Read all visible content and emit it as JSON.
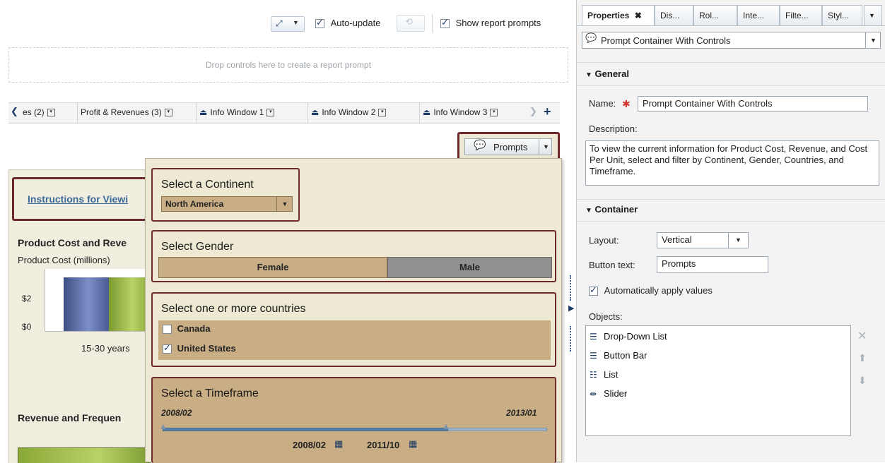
{
  "toolbar": {
    "auto_update_label": "Auto-update",
    "show_prompts_label": "Show report prompts"
  },
  "drop_zone": {
    "text": "Drop controls here to create a report prompt"
  },
  "report_tabs": [
    {
      "label": "es (2)"
    },
    {
      "label": "Profit & Revenues (3)"
    },
    {
      "label": "Info Window 1"
    },
    {
      "label": "Info Window 2"
    },
    {
      "label": "Info Window 3"
    }
  ],
  "prompts_button": {
    "label": "Prompts"
  },
  "report": {
    "instructions_link": "Instructions for Viewi",
    "chart1_title": "Product Cost and Reve",
    "chart1_ylabel": "Product Cost (millions)",
    "chart1_ticks": [
      "$2",
      "$0"
    ],
    "chart1_category": "15-30 years",
    "chart2_title": "Revenue and Frequen"
  },
  "prompt_panel": {
    "continent": {
      "title": "Select a Continent",
      "value": "North America"
    },
    "gender": {
      "title": "Select Gender",
      "options": [
        "Female",
        "Male"
      ],
      "selected": "Female"
    },
    "countries": {
      "title": "Select one or more countries",
      "items": [
        {
          "label": "Canada",
          "checked": false
        },
        {
          "label": "United States",
          "checked": true
        }
      ]
    },
    "timeframe": {
      "title": "Select a Timeframe",
      "min": "2008/02",
      "max": "2013/01",
      "low": "2008/02",
      "high": "2011/10"
    }
  },
  "properties": {
    "tabs": [
      "Properties",
      "Dis...",
      "Rol...",
      "Inte...",
      "Filte...",
      "Styl..."
    ],
    "object_select": "Prompt Container With Controls",
    "general_header": "General",
    "name_label": "Name:",
    "name_value": "Prompt Container With Controls",
    "description_label": "Description:",
    "description_value": "To view the current information for Product Cost, Revenue, and Cost Per Unit, select and filter by Continent, Gender, Countries, and Timeframe.",
    "container_header": "Container",
    "layout_label": "Layout:",
    "layout_value": "Vertical",
    "button_text_label": "Button text:",
    "button_text_value": "Prompts",
    "auto_apply_label": "Automatically apply values",
    "objects_label": "Objects:",
    "objects": [
      {
        "label": "Drop-Down List",
        "icon": "dropdown-list-icon"
      },
      {
        "label": "Button Bar",
        "icon": "button-bar-icon"
      },
      {
        "label": "List",
        "icon": "list-icon"
      },
      {
        "label": "Slider",
        "icon": "slider-icon"
      }
    ]
  },
  "colors": {
    "accent": "#6e2a2a",
    "prompt_bg": "#ede9d3",
    "control_tan": "#c9ae85",
    "link": "#3a6a9a"
  }
}
